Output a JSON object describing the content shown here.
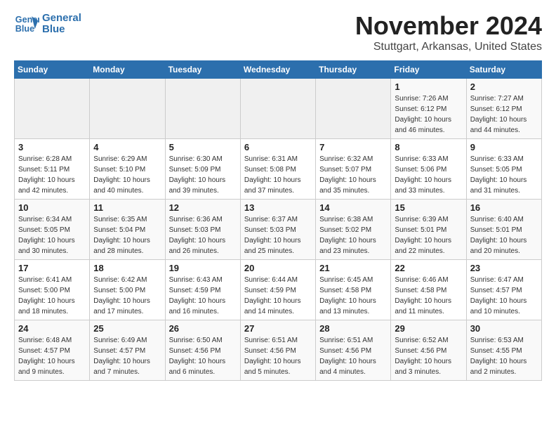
{
  "header": {
    "logo_line1": "General",
    "logo_line2": "Blue",
    "month": "November 2024",
    "location": "Stuttgart, Arkansas, United States"
  },
  "weekdays": [
    "Sunday",
    "Monday",
    "Tuesday",
    "Wednesday",
    "Thursday",
    "Friday",
    "Saturday"
  ],
  "weeks": [
    [
      {
        "day": "",
        "info": ""
      },
      {
        "day": "",
        "info": ""
      },
      {
        "day": "",
        "info": ""
      },
      {
        "day": "",
        "info": ""
      },
      {
        "day": "",
        "info": ""
      },
      {
        "day": "1",
        "info": "Sunrise: 7:26 AM\nSunset: 6:12 PM\nDaylight: 10 hours\nand 46 minutes."
      },
      {
        "day": "2",
        "info": "Sunrise: 7:27 AM\nSunset: 6:12 PM\nDaylight: 10 hours\nand 44 minutes."
      }
    ],
    [
      {
        "day": "3",
        "info": "Sunrise: 6:28 AM\nSunset: 5:11 PM\nDaylight: 10 hours\nand 42 minutes."
      },
      {
        "day": "4",
        "info": "Sunrise: 6:29 AM\nSunset: 5:10 PM\nDaylight: 10 hours\nand 40 minutes."
      },
      {
        "day": "5",
        "info": "Sunrise: 6:30 AM\nSunset: 5:09 PM\nDaylight: 10 hours\nand 39 minutes."
      },
      {
        "day": "6",
        "info": "Sunrise: 6:31 AM\nSunset: 5:08 PM\nDaylight: 10 hours\nand 37 minutes."
      },
      {
        "day": "7",
        "info": "Sunrise: 6:32 AM\nSunset: 5:07 PM\nDaylight: 10 hours\nand 35 minutes."
      },
      {
        "day": "8",
        "info": "Sunrise: 6:33 AM\nSunset: 5:06 PM\nDaylight: 10 hours\nand 33 minutes."
      },
      {
        "day": "9",
        "info": "Sunrise: 6:33 AM\nSunset: 5:05 PM\nDaylight: 10 hours\nand 31 minutes."
      }
    ],
    [
      {
        "day": "10",
        "info": "Sunrise: 6:34 AM\nSunset: 5:05 PM\nDaylight: 10 hours\nand 30 minutes."
      },
      {
        "day": "11",
        "info": "Sunrise: 6:35 AM\nSunset: 5:04 PM\nDaylight: 10 hours\nand 28 minutes."
      },
      {
        "day": "12",
        "info": "Sunrise: 6:36 AM\nSunset: 5:03 PM\nDaylight: 10 hours\nand 26 minutes."
      },
      {
        "day": "13",
        "info": "Sunrise: 6:37 AM\nSunset: 5:03 PM\nDaylight: 10 hours\nand 25 minutes."
      },
      {
        "day": "14",
        "info": "Sunrise: 6:38 AM\nSunset: 5:02 PM\nDaylight: 10 hours\nand 23 minutes."
      },
      {
        "day": "15",
        "info": "Sunrise: 6:39 AM\nSunset: 5:01 PM\nDaylight: 10 hours\nand 22 minutes."
      },
      {
        "day": "16",
        "info": "Sunrise: 6:40 AM\nSunset: 5:01 PM\nDaylight: 10 hours\nand 20 minutes."
      }
    ],
    [
      {
        "day": "17",
        "info": "Sunrise: 6:41 AM\nSunset: 5:00 PM\nDaylight: 10 hours\nand 18 minutes."
      },
      {
        "day": "18",
        "info": "Sunrise: 6:42 AM\nSunset: 5:00 PM\nDaylight: 10 hours\nand 17 minutes."
      },
      {
        "day": "19",
        "info": "Sunrise: 6:43 AM\nSunset: 4:59 PM\nDaylight: 10 hours\nand 16 minutes."
      },
      {
        "day": "20",
        "info": "Sunrise: 6:44 AM\nSunset: 4:59 PM\nDaylight: 10 hours\nand 14 minutes."
      },
      {
        "day": "21",
        "info": "Sunrise: 6:45 AM\nSunset: 4:58 PM\nDaylight: 10 hours\nand 13 minutes."
      },
      {
        "day": "22",
        "info": "Sunrise: 6:46 AM\nSunset: 4:58 PM\nDaylight: 10 hours\nand 11 minutes."
      },
      {
        "day": "23",
        "info": "Sunrise: 6:47 AM\nSunset: 4:57 PM\nDaylight: 10 hours\nand 10 minutes."
      }
    ],
    [
      {
        "day": "24",
        "info": "Sunrise: 6:48 AM\nSunset: 4:57 PM\nDaylight: 10 hours\nand 9 minutes."
      },
      {
        "day": "25",
        "info": "Sunrise: 6:49 AM\nSunset: 4:57 PM\nDaylight: 10 hours\nand 7 minutes."
      },
      {
        "day": "26",
        "info": "Sunrise: 6:50 AM\nSunset: 4:56 PM\nDaylight: 10 hours\nand 6 minutes."
      },
      {
        "day": "27",
        "info": "Sunrise: 6:51 AM\nSunset: 4:56 PM\nDaylight: 10 hours\nand 5 minutes."
      },
      {
        "day": "28",
        "info": "Sunrise: 6:51 AM\nSunset: 4:56 PM\nDaylight: 10 hours\nand 4 minutes."
      },
      {
        "day": "29",
        "info": "Sunrise: 6:52 AM\nSunset: 4:56 PM\nDaylight: 10 hours\nand 3 minutes."
      },
      {
        "day": "30",
        "info": "Sunrise: 6:53 AM\nSunset: 4:55 PM\nDaylight: 10 hours\nand 2 minutes."
      }
    ]
  ]
}
